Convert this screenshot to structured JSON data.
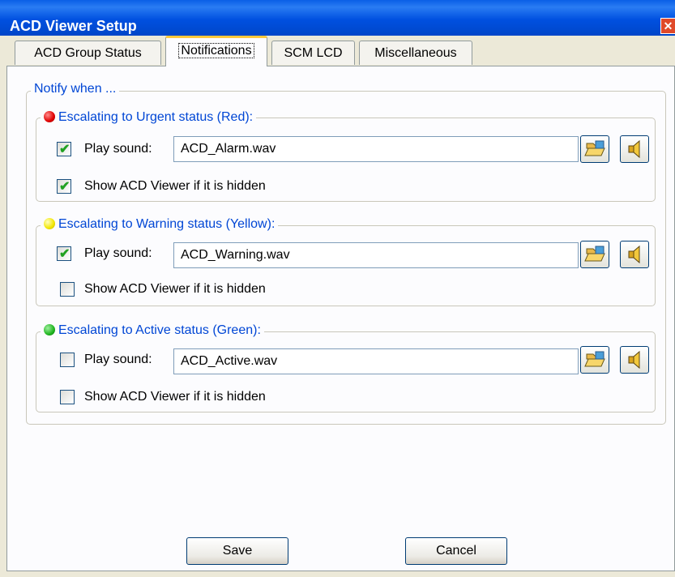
{
  "window": {
    "title": "ACD Viewer Setup",
    "close_glyph": "✕"
  },
  "tabs": [
    {
      "label": "ACD Group Status"
    },
    {
      "label": "Notifications",
      "active": true
    },
    {
      "label": "SCM LCD"
    },
    {
      "label": "Miscellaneous"
    }
  ],
  "notify": {
    "legend": "Notify when ...",
    "groups": [
      {
        "legend": "Escalating to Urgent status (Red):",
        "status_color": "#e00000",
        "play_sound_label": "Play sound:",
        "play_sound_checked": true,
        "sound_file": "ACD_Alarm.wav",
        "show_viewer_label": "Show ACD Viewer if it is hidden",
        "show_viewer_checked": true
      },
      {
        "legend": "Escalating to Warning status (Yellow):",
        "status_color": "#f2e600",
        "play_sound_label": "Play sound:",
        "play_sound_checked": true,
        "sound_file": "ACD_Warning.wav",
        "show_viewer_label": "Show ACD Viewer if it is hidden",
        "show_viewer_checked": false
      },
      {
        "legend": "Escalating to Active status (Green):",
        "status_color": "#1fb51f",
        "play_sound_label": "Play sound:",
        "play_sound_checked": false,
        "sound_file": "ACD_Active.wav",
        "show_viewer_label": "Show ACD Viewer if it is hidden",
        "show_viewer_checked": false
      }
    ]
  },
  "icons": {
    "browse": "folder-open-icon",
    "play": "speaker-icon"
  },
  "buttons": {
    "save": "Save",
    "cancel": "Cancel"
  },
  "check_glyph": "✔"
}
